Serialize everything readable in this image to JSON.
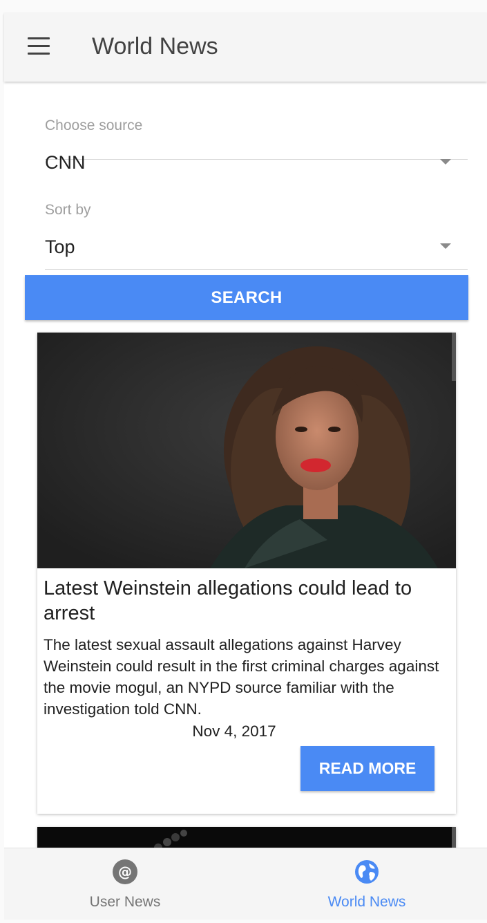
{
  "header": {
    "title": "World News"
  },
  "filters": {
    "source_label": "Choose source",
    "source_value": "CNN",
    "sort_label": "Sort by",
    "sort_value": "Top"
  },
  "search_label": "SEARCH",
  "articles": [
    {
      "title": "Latest Weinstein allegations could lead to arrest",
      "description": "The latest sexual assault allegations against Harvey Weinstein could result in the first criminal charges against the movie mogul, an NYPD source familiar with the investigation told CNN.",
      "date": "Nov 4, 2017",
      "read_more_label": "READ MORE",
      "image_icon": "photo-portrait"
    }
  ],
  "bottom_nav": {
    "items": [
      {
        "label": "User News",
        "icon": "at-sign-icon",
        "active": false
      },
      {
        "label": "World News",
        "icon": "globe-icon",
        "active": true
      }
    ]
  },
  "colors": {
    "accent": "#4a8af4",
    "inactive": "#757575",
    "text": "#212121"
  }
}
